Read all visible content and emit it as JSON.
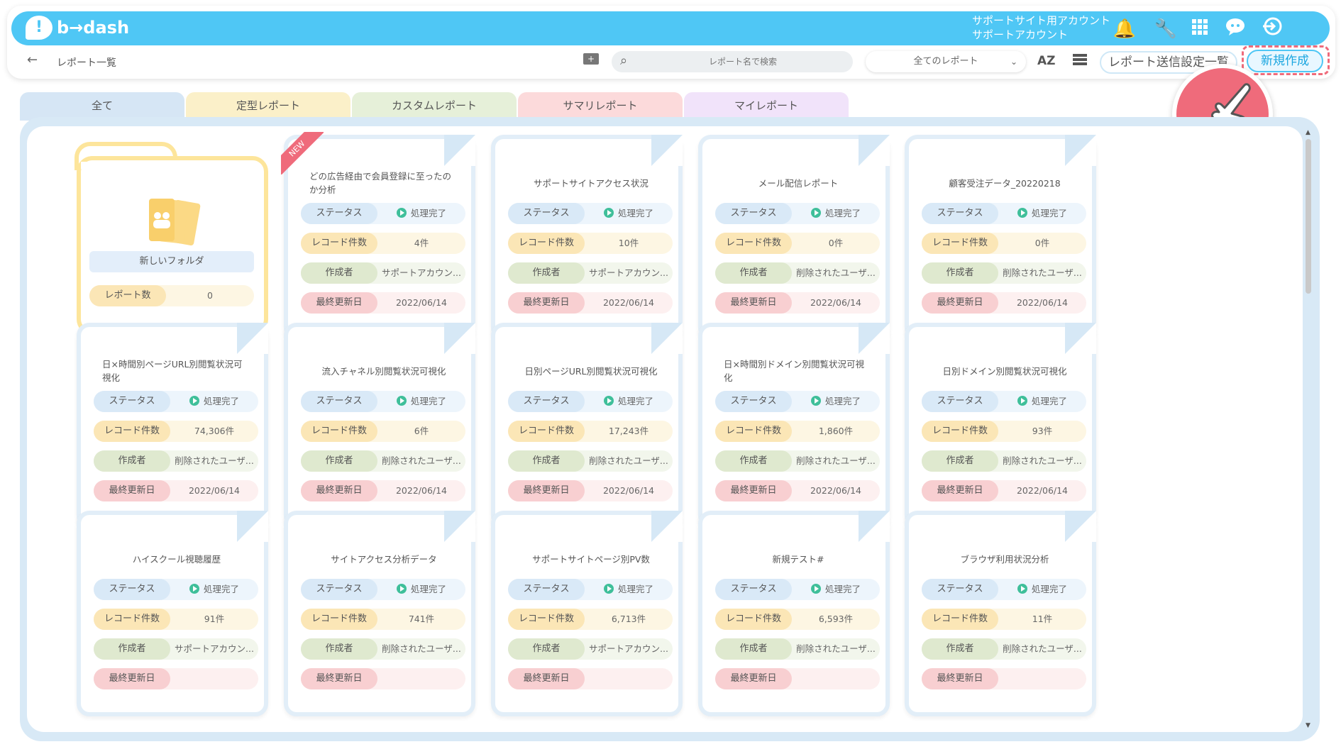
{
  "app": {
    "logo_text": "b→dash",
    "account_line1": "サポートサイト用アカウント",
    "account_line2": "サポートアカウント"
  },
  "icons": {
    "notify": "bell-icon",
    "tools": "wrench-icon",
    "apps": "grid-icon",
    "chat": "chat-icon",
    "logout": "logout-icon"
  },
  "toolbar": {
    "breadcrumb": "レポート一覧",
    "search_placeholder": "レポート名で検索",
    "filter_value": "全てのレポート",
    "sort_label": "AZ",
    "send_settings_label": "レポート送信設定一覧",
    "new_button_label": "新規作成"
  },
  "tabs": [
    {
      "label": "全て",
      "color": "#d6e6f5"
    },
    {
      "label": "定型レポート",
      "color": "#fbf0c9"
    },
    {
      "label": "カスタムレポート",
      "color": "#e6f0d9"
    },
    {
      "label": "サマリレポート",
      "color": "#fcdadb"
    },
    {
      "label": "マイレポート",
      "color": "#f1e3fa"
    }
  ],
  "row_labels": {
    "status": "ステータス",
    "count": "レコード件数",
    "author": "作成者",
    "updated": "最終更新日"
  },
  "folder": {
    "name": "新しいフォルダ",
    "count_label": "レポート数",
    "count": "0"
  },
  "new_badge": "NEW",
  "reports": [
    {
      "title": "どの広告経由で会員登録に至ったのか分析",
      "status": "処理完了",
      "count": "4件",
      "author": "サポートアカウン...",
      "updated": "2022/06/14"
    },
    {
      "title": "サポートサイトアクセス状況",
      "status": "処理完了",
      "count": "10件",
      "author": "サポートアカウン...",
      "updated": "2022/06/14"
    },
    {
      "title": "メール配信レポート",
      "status": "処理完了",
      "count": "0件",
      "author": "削除されたユーザ...",
      "updated": "2022/06/14"
    },
    {
      "title": "顧客受注データ_20220218",
      "status": "処理完了",
      "count": "0件",
      "author": "削除されたユーザ...",
      "updated": "2022/06/14"
    },
    {
      "title": "日×時間別ページURL別閲覧状況可視化",
      "status": "処理完了",
      "count": "74,306件",
      "author": "削除されたユーザ...",
      "updated": "2022/06/14"
    },
    {
      "title": "流入チャネル別閲覧状況可視化",
      "status": "処理完了",
      "count": "6件",
      "author": "削除されたユーザ...",
      "updated": "2022/06/14"
    },
    {
      "title": "日別ページURL別閲覧状況可視化",
      "status": "処理完了",
      "count": "17,243件",
      "author": "削除されたユーザ...",
      "updated": "2022/06/14"
    },
    {
      "title": "日×時間別ドメイン別閲覧状況可視化",
      "status": "処理完了",
      "count": "1,860件",
      "author": "削除されたユーザ...",
      "updated": "2022/06/14"
    },
    {
      "title": "日別ドメイン別閲覧状況可視化",
      "status": "処理完了",
      "count": "93件",
      "author": "削除されたユーザ...",
      "updated": "2022/06/14"
    },
    {
      "title": "ハイスクール視聴履歴",
      "status": "処理完了",
      "count": "91件",
      "author": "サポートアカウン...",
      "updated": ""
    },
    {
      "title": "サイトアクセス分析データ",
      "status": "処理完了",
      "count": "741件",
      "author": "削除されたユーザ...",
      "updated": ""
    },
    {
      "title": "サポートサイトページ別PV数",
      "status": "処理完了",
      "count": "6,713件",
      "author": "サポートアカウン...",
      "updated": ""
    },
    {
      "title": "新規テスト#",
      "status": "処理完了",
      "count": "6,593件",
      "author": "削除されたユーザ...",
      "updated": ""
    },
    {
      "title": "ブラウザ利用状況分析",
      "status": "処理完了",
      "count": "11件",
      "author": "削除されたユーザ...",
      "updated": ""
    }
  ]
}
